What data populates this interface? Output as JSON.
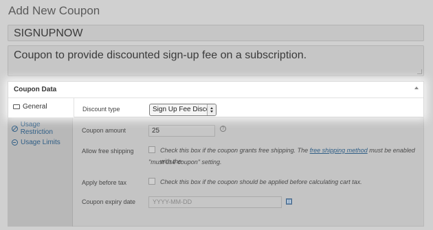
{
  "page": {
    "title": "Add New Coupon"
  },
  "coupon": {
    "code": "SIGNUPNOW",
    "description": "Coupon to provide discounted sign-up fee on a subscription."
  },
  "panel": {
    "title": "Coupon Data",
    "tabs": [
      {
        "label": "General",
        "icon": "ticket-icon",
        "active": true
      },
      {
        "label": "Usage Restriction",
        "icon": "restriction-icon",
        "active": false
      },
      {
        "label": "Usage Limits",
        "icon": "limits-icon",
        "active": false
      }
    ]
  },
  "fields": {
    "discount_type": {
      "label": "Discount type",
      "value": "Sign Up Fee Discount"
    },
    "coupon_amount": {
      "label": "Coupon amount",
      "value": "25",
      "help": "?"
    },
    "free_shipping": {
      "label": "Allow free shipping",
      "desc_before": "Check this box if the coupon grants free shipping. The ",
      "link": "free shipping method",
      "desc_after": " must be enabled with the",
      "desc_line2": "\"must use coupon\" setting.",
      "checked": false
    },
    "apply_before_tax": {
      "label": "Apply before tax",
      "desc": "Check this box if the coupon should be applied before calculating cart tax.",
      "checked": false
    },
    "expiry_date": {
      "label": "Coupon expiry date",
      "placeholder": "YYYY-MM-DD"
    }
  },
  "colors": {
    "link": "#2f5e86",
    "overlay": "#d0d0d0",
    "highlight": "#ffffff"
  }
}
